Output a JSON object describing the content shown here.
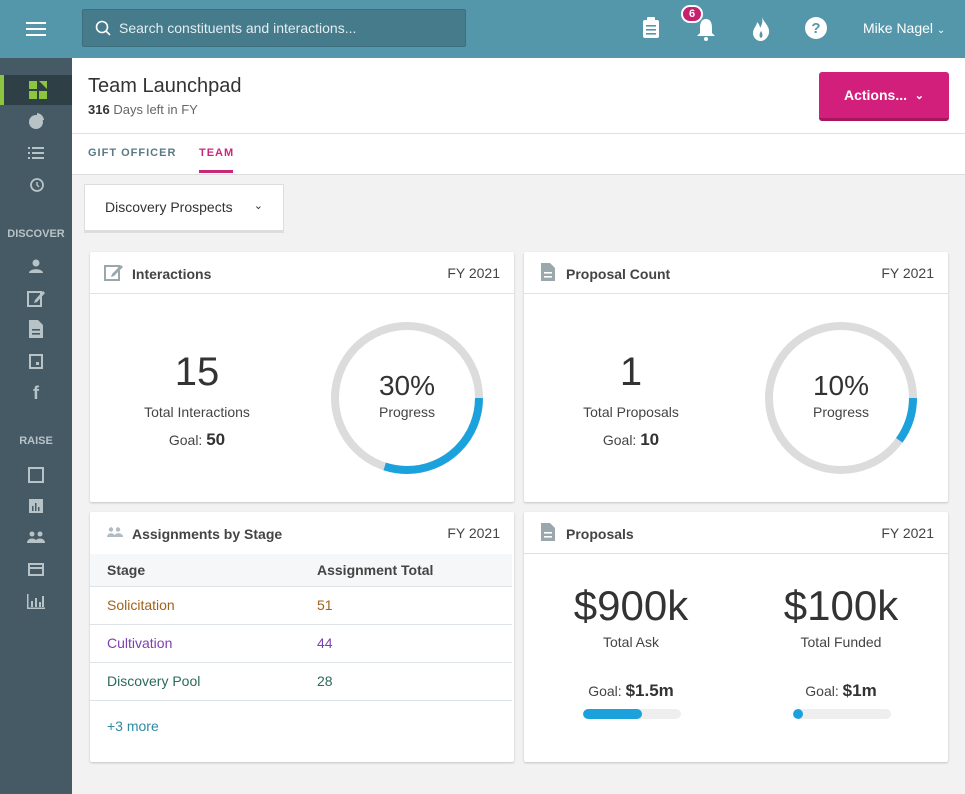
{
  "topbar": {
    "search_placeholder": "Search constituents and interactions...",
    "notifications_count": "6",
    "user_name": "Mike Nagel",
    "icons": [
      "menu-icon",
      "search-icon",
      "clipboard-icon",
      "bell-icon",
      "flame-icon",
      "help-icon",
      "chevron-down-icon"
    ]
  },
  "sidebar": {
    "discover_label": "DISCOVER",
    "raise_label": "RAISE",
    "active_color": "#8cc63f"
  },
  "header": {
    "title": "Team Launchpad",
    "days_left": "316",
    "days_left_suffix": "Days left in FY",
    "actions_label": "Actions...",
    "actions_color": "#d31f7c"
  },
  "tabs": [
    {
      "label": "GIFT OFFICER",
      "active": false
    },
    {
      "label": "TEAM",
      "active": true
    }
  ],
  "filter": {
    "selected": "Discovery Prospects"
  },
  "interactions": {
    "title": "Interactions",
    "fy": "FY 2021",
    "total": "15",
    "total_label": "Total Interactions",
    "goal_label": "Goal:",
    "goal": "50",
    "progress": 30,
    "progress_text": "30%",
    "progress_label": "Progress"
  },
  "proposal_count": {
    "title": "Proposal Count",
    "fy": "FY 2021",
    "total": "1",
    "total_label": "Total Proposals",
    "goal_label": "Goal:",
    "goal": "10",
    "progress": 10,
    "progress_text": "10%",
    "progress_label": "Progress"
  },
  "assignments": {
    "title": "Assignments by Stage",
    "fy": "FY 2021",
    "headers": [
      "Stage",
      "Assignment Total"
    ],
    "rows": [
      {
        "stage": "Solicitation",
        "total": "51",
        "color": "#a0621a"
      },
      {
        "stage": "Cultivation",
        "total": "44",
        "color": "#7e3fb0"
      },
      {
        "stage": "Discovery Pool",
        "total": "28",
        "color": "#2a6a5a"
      }
    ],
    "more": "+3 more"
  },
  "proposals": {
    "title": "Proposals",
    "fy": "FY 2021",
    "ask": {
      "value": "$900k",
      "label": "Total Ask",
      "goal_label": "Goal:",
      "goal": "$1.5m",
      "progress": 60
    },
    "funded": {
      "value": "$100k",
      "label": "Total Funded",
      "goal_label": "Goal:",
      "goal": "$1m",
      "progress": 10
    }
  },
  "colors": {
    "progress": "#1ba1dc",
    "track": "#dcdcdc",
    "topbar": "#5597aa",
    "sidebar": "#455a64"
  }
}
